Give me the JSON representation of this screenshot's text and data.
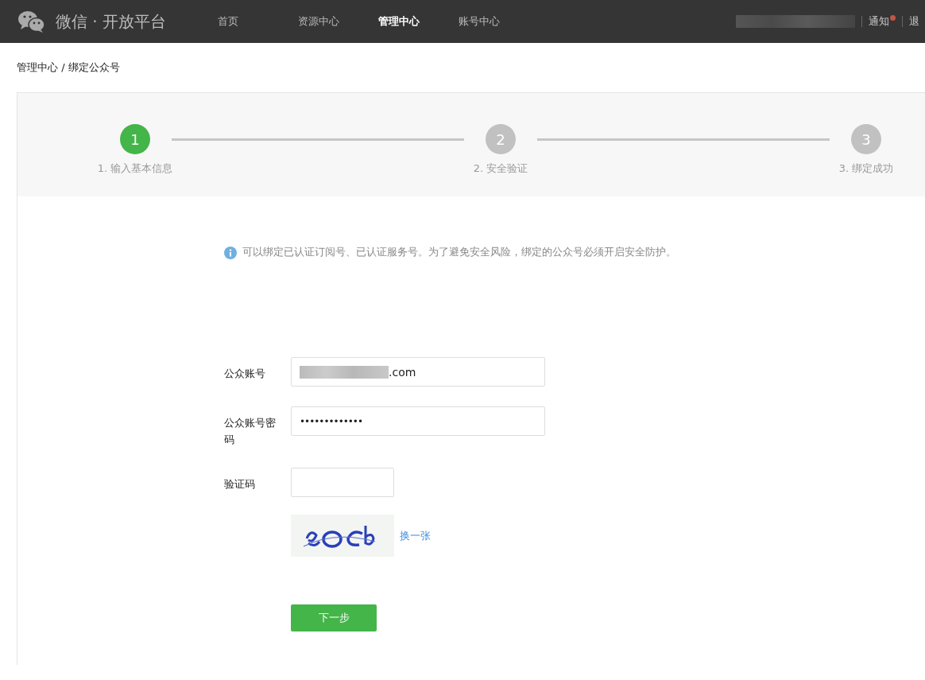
{
  "header": {
    "brand": "微信 · 开放平台",
    "nav": [
      {
        "label": "首页",
        "selected": false
      },
      {
        "label": "资源中心",
        "selected": false
      },
      {
        "label": "管理中心",
        "selected": true
      },
      {
        "label": "账号中心",
        "selected": false
      }
    ],
    "notice": {
      "label": "通知",
      "unread": true
    },
    "logout": "退"
  },
  "breadcrumb": "管理中心 / 绑定公众号",
  "steps": [
    {
      "number": "1",
      "label": "1. 输入基本信息",
      "active": true
    },
    {
      "number": "2",
      "label": "2. 安全验证",
      "active": false
    },
    {
      "number": "3",
      "label": "3. 绑定成功",
      "active": false
    }
  ],
  "notice": "可以绑定已认证订阅号、已认证服务号。为了避免安全风险，绑定的公众号必须开启安全防护。",
  "form": {
    "fields": [
      {
        "kind": "email",
        "label": "公众账号",
        "value": ".com"
      },
      {
        "kind": "password",
        "label": "公众账号密码",
        "value": "•••••••••••••"
      },
      {
        "kind": "captcha",
        "label": "验证码"
      }
    ],
    "refresh_link": "换一张",
    "submit": "下一步"
  }
}
